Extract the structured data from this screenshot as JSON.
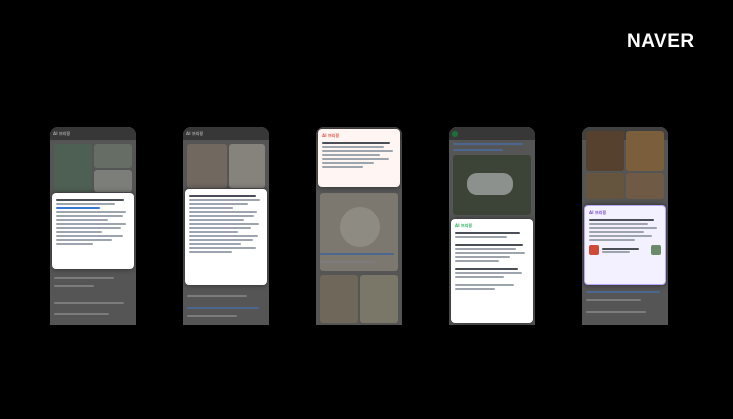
{
  "brand": {
    "logo_text": "NAVER",
    "logo_color": "#ffffff"
  },
  "background_color": "#000000",
  "phones": [
    {
      "label": "phone-1",
      "badge": "AI 브리핑",
      "card_header": "",
      "accent": "#1f5fc5"
    },
    {
      "label": "phone-2",
      "badge": "AI 브리핑",
      "card_header": "",
      "accent": "#1f5fc5"
    },
    {
      "label": "phone-3",
      "badge": "",
      "card_header": "AI 브리핑",
      "accent": "#e05a4a"
    },
    {
      "label": "phone-4",
      "badge": "",
      "card_header": "AI 브리핑",
      "accent": "#2fb35b"
    },
    {
      "label": "phone-5",
      "badge": "",
      "card_header": "AI 브리핑",
      "accent": "#7a4fd0"
    }
  ]
}
